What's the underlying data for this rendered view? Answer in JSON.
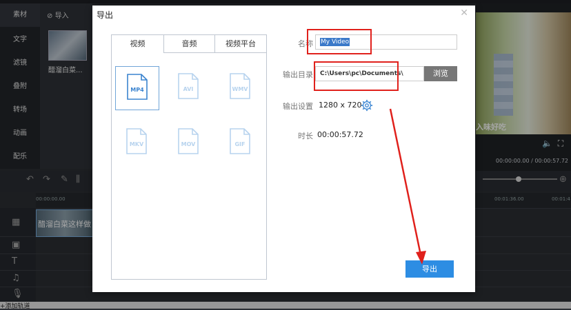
{
  "left_nav": [
    "素材",
    "文字",
    "滤镜",
    "叠附",
    "转场",
    "动画",
    "配乐"
  ],
  "media_toolbar": {
    "import_label": "导入"
  },
  "media": {
    "clip_name": "醋溜白菜..."
  },
  "preview": {
    "caption": "入味好吃",
    "time": "00:00:00.00 / 00:00:57.72"
  },
  "timeline": {
    "ruler_start": "00:00:00.00",
    "ruler_mid": "00:01:36.00",
    "ruler_end": "00:01:4",
    "clip_label": "醋溜白菜这样做",
    "add_track_label": "+添加轨道"
  },
  "dialog": {
    "title": "导出",
    "tabs": [
      "视频",
      "音频",
      "视频平台"
    ],
    "formats": [
      "MP4",
      "AVI",
      "WMV",
      "MKV",
      "MOV",
      "GIF"
    ],
    "selected_format": "MP4",
    "name_label": "名称",
    "name_value": "My Video",
    "dir_label": "输出目录",
    "dir_value": "C:\\Users\\pc\\Documents\\",
    "browse_label": "浏览",
    "settings_label": "输出设置",
    "settings_value": "1280 x 720",
    "duration_label": "时长",
    "duration_value": "00:00:57.72",
    "export_label": "导出"
  },
  "colors": {
    "accent": "#2d8de3",
    "annotation": "#e0201b",
    "icon": "#b7d3ee"
  }
}
